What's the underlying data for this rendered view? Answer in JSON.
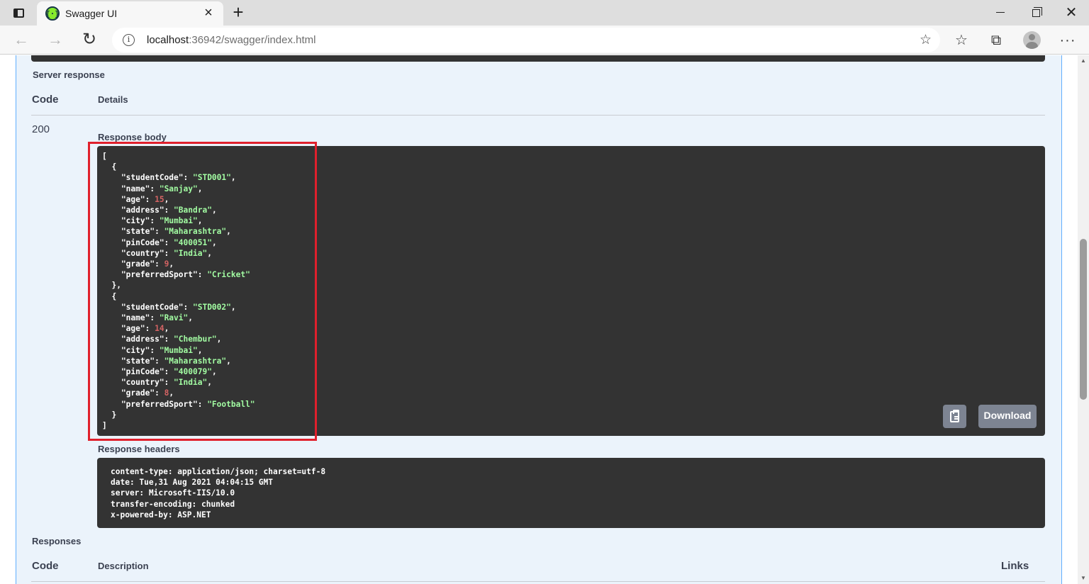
{
  "browser": {
    "tab_title": "Swagger UI",
    "tab_favicon": "{·}",
    "new_tab_label": "+",
    "tab_close_label": "×",
    "window_close_label": "✕",
    "url_host": "localhost",
    "url_rest": ":36942/swagger/index.html",
    "icons": {
      "back": "←",
      "forward": "→",
      "reload": "↻",
      "info": "i",
      "add_favorite": "☆",
      "favorites": "☆",
      "collections": "⧉",
      "more": "···"
    }
  },
  "page": {
    "server_response_label": "Server response",
    "code_header": "Code",
    "details_header": "Details",
    "response_code": "200",
    "response_body_label": "Response body",
    "response_body": {
      "open": "[",
      "close": "]",
      "items": [
        {
          "studentCode": "STD001",
          "name": "Sanjay",
          "age": 15,
          "address": "Bandra",
          "city": "Mumbai",
          "state": "Maharashtra",
          "pinCode": "400051",
          "country": "India",
          "grade": 9,
          "preferredSport": "Cricket"
        },
        {
          "studentCode": "STD002",
          "name": "Ravi",
          "age": 14,
          "address": "Chembur",
          "city": "Mumbai",
          "state": "Maharashtra",
          "pinCode": "400079",
          "country": "India",
          "grade": 8,
          "preferredSport": "Football"
        }
      ]
    },
    "download_label": "Download",
    "response_headers_label": "Response headers",
    "response_headers": [
      "content-type: application/json; charset=utf-8",
      "date: Tue,31 Aug 2021 04:04:15 GMT",
      "server: Microsoft-IIS/10.0",
      "transfer-encoding: chunked",
      "x-powered-by: ASP.NET"
    ],
    "responses_label": "Responses",
    "responses_code_header": "Code",
    "responses_description_header": "Description",
    "responses_links_header": "Links"
  },
  "colors": {
    "highlight": "#e0202c",
    "json_string": "#a2fca2",
    "json_number": "#d36363",
    "code_bg": "#333333",
    "opblock_bg": "#ebf3fb"
  }
}
